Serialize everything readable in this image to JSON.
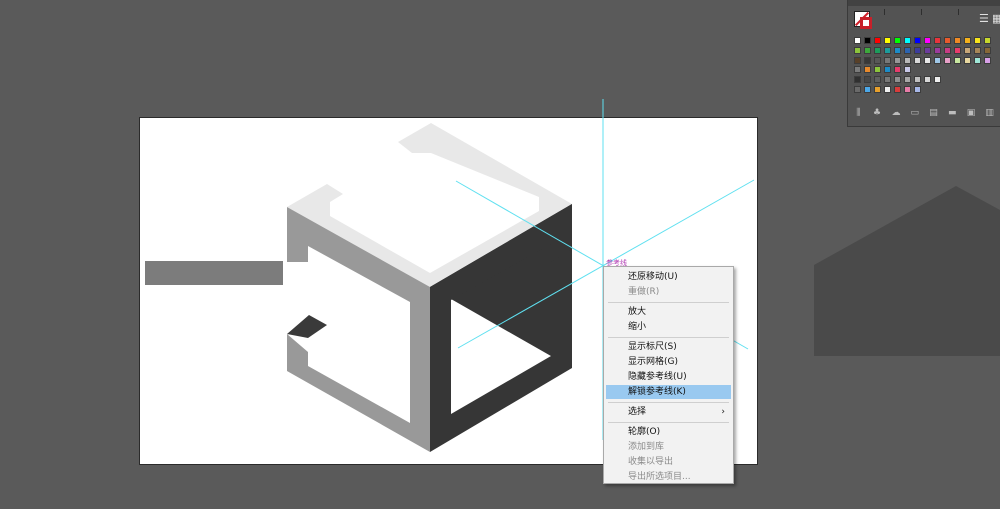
{
  "canvas": {
    "background": "#5a5a5a",
    "artboard_color": "#ffffff",
    "guide_color": "#5fe0f0"
  },
  "guide_label": "参考线",
  "context_menu": {
    "items": [
      {
        "label": "还原移动(U)",
        "enabled": true
      },
      {
        "label": "重做(R)",
        "enabled": false
      },
      {
        "separator": true
      },
      {
        "label": "放大",
        "enabled": true
      },
      {
        "label": "缩小",
        "enabled": true
      },
      {
        "separator": true
      },
      {
        "label": "显示标尺(S)",
        "enabled": true
      },
      {
        "label": "显示网格(G)",
        "enabled": true
      },
      {
        "label": "隐藏参考线(U)",
        "enabled": true
      },
      {
        "label": "解锁参考线(K)",
        "enabled": true,
        "highlighted": true
      },
      {
        "separator": true
      },
      {
        "label": "选择",
        "enabled": true,
        "submenu": true
      },
      {
        "separator": true
      },
      {
        "label": "轮廓(O)",
        "enabled": true
      },
      {
        "label": "添加到库",
        "enabled": false
      },
      {
        "label": "收集以导出",
        "enabled": false
      },
      {
        "label": "导出所选项目...",
        "enabled": false
      }
    ],
    "submenu_arrow": "›"
  },
  "swatches_panel": {
    "list_view_icon": "☰",
    "grid_view_icon": "▦",
    "rows": [
      [
        "#ffffff",
        "#000000",
        "#ff0000",
        "#ffff00",
        "#00ff00",
        "#00ffff",
        "#0000ff",
        "#ff00ff",
        "#e8343c",
        "#e85a2c",
        "#f08a24",
        "#f4b21c",
        "#f8e51c",
        "#c8d82c"
      ],
      [
        "#8cc43c",
        "#3ca83c",
        "#1c9c5c",
        "#1c9c9c",
        "#1c8cc8",
        "#2c64b0",
        "#3c3c9c",
        "#6c3c9c",
        "#9c3c9c",
        "#c83c84",
        "#e83c6c",
        "#c8a878",
        "#a88858",
        "#886838"
      ],
      [
        "#584028",
        "#383838",
        "#585858",
        "#787878",
        "#989898",
        "#b8b8b8",
        "#d8d8d8",
        "#e8e8e8",
        "#a0c8e8",
        "#e8a0c8",
        "#c8e8a0",
        "#e8d8a0",
        "#a0e8d8",
        "#d8a0e8"
      ],
      [
        "#7b7b7b",
        "#e88a2c",
        "#8cc43c",
        "#1c8cc8",
        "#e83c6c",
        "#c8c8e8"
      ],
      [
        "#303030",
        "#484848",
        "#606060",
        "#787878",
        "#909090",
        "#a8a8a8",
        "#c0c0c0",
        "#d8d8d8",
        "#f0f0f0"
      ],
      [
        "#6a6a6a",
        "#4ca8e8",
        "#e8a02c",
        "#f0f0f0",
        "#d83c3c",
        "#e87ca8",
        "#a8b8e8"
      ]
    ],
    "bottom_icons": [
      "library-icon",
      "swatch-kind-icon",
      "cloud-icon",
      "options-icon",
      "group-icon",
      "folder-icon",
      "new-swatch-icon",
      "delete-icon"
    ]
  }
}
